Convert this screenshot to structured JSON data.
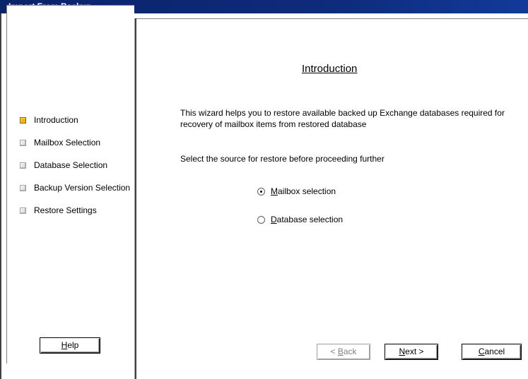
{
  "window": {
    "title": "Import From Backup"
  },
  "sidebar": {
    "steps": [
      {
        "label": "Introduction",
        "active": true
      },
      {
        "label": "Mailbox Selection",
        "active": false
      },
      {
        "label": "Database Selection",
        "active": false
      },
      {
        "label": "Backup Version Selection",
        "active": false
      },
      {
        "label": "Restore Settings",
        "active": false
      }
    ],
    "help_label_hotkey": "H",
    "help_label_rest": "elp"
  },
  "main": {
    "heading": "Introduction",
    "intro_text": "This wizard helps you to restore available backed up Exchange databases required for recovery of mailbox items from restored database",
    "select_text": "Select the source for restore before proceeding further",
    "options": [
      {
        "hotkey": "M",
        "rest": "ailbox selection",
        "checked": true
      },
      {
        "hotkey": "D",
        "rest": "atabase selection",
        "checked": false
      }
    ]
  },
  "footer": {
    "back_prefix": "< ",
    "back_hotkey": "B",
    "back_rest": "ack",
    "next_hotkey": "N",
    "next_rest": "ext >",
    "cancel_hotkey": "C",
    "cancel_rest": "ancel"
  },
  "colors": {
    "titlebar": "#0a246a",
    "active_step": "#f2b400"
  }
}
